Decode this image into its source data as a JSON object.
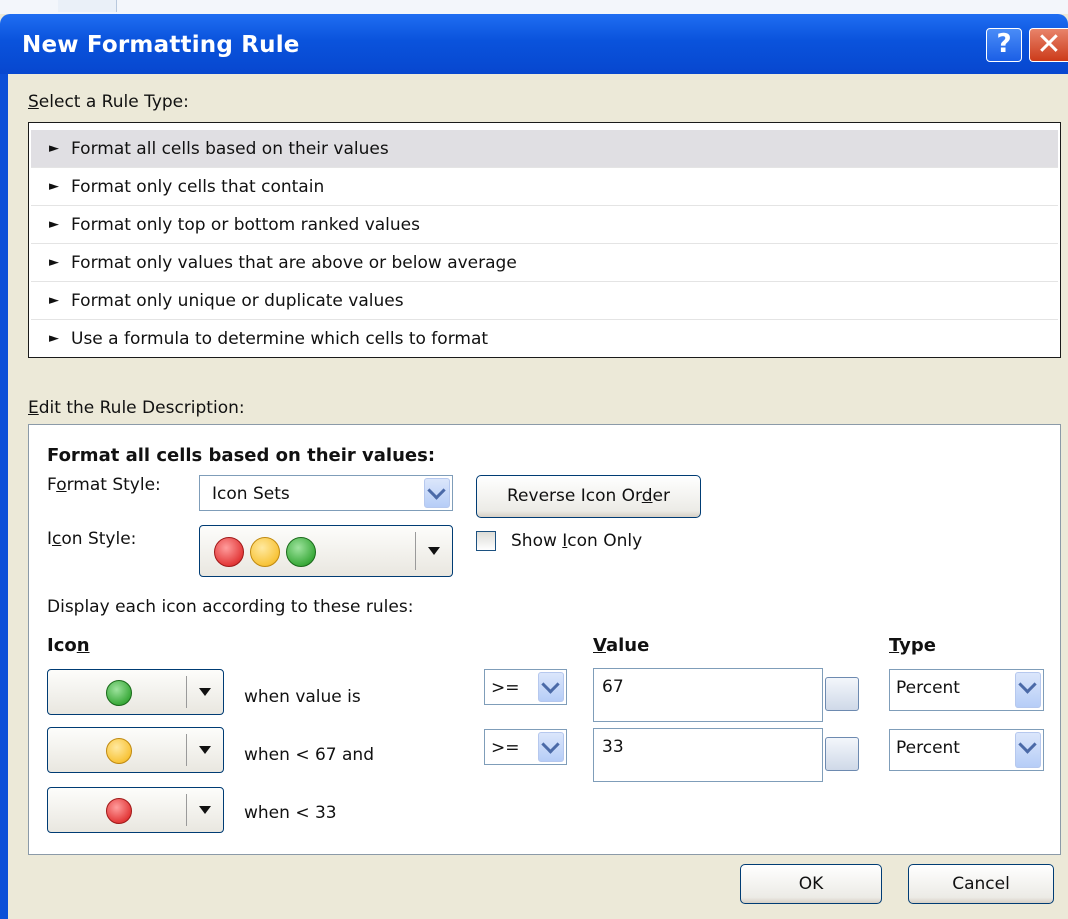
{
  "window": {
    "title": "New Formatting Rule",
    "help_label": "?",
    "close_label": "✕"
  },
  "rule_type": {
    "label_pre": "",
    "label_key": "S",
    "label_post": "elect a Rule Type:",
    "items": [
      {
        "label": "Format all cells based on their values",
        "selected": true
      },
      {
        "label": "Format only cells that contain",
        "selected": false
      },
      {
        "label": "Format only top or bottom ranked values",
        "selected": false
      },
      {
        "label": "Format only values that are above or below average",
        "selected": false
      },
      {
        "label": "Format only unique or duplicate values",
        "selected": false
      },
      {
        "label": "Use a formula to determine which cells to format",
        "selected": false
      }
    ],
    "bullet": "►"
  },
  "description": {
    "label_key": "E",
    "label_post": "dit the Rule Description:",
    "heading": "Format all cells based on their values:",
    "format_style": {
      "label_pre": "F",
      "label_key": "o",
      "label_post": "rmat Style:",
      "value": "Icon Sets"
    },
    "reverse_button": {
      "pre": "Reverse Icon Or",
      "key": "d",
      "post": "er"
    },
    "icon_style": {
      "label_pre": "I",
      "label_key": "c",
      "label_post": "on Style:",
      "icons": [
        "red",
        "yellow",
        "green"
      ]
    },
    "show_icon_only": {
      "pre": "Show ",
      "key": "I",
      "post": "con Only",
      "checked": false
    },
    "display_rules_label": "Display each icon according to these rules:",
    "columns": {
      "icon": {
        "pre": "Ico",
        "key": "n",
        "post": ""
      },
      "value": {
        "pre": "",
        "key": "V",
        "post": "alue"
      },
      "type": {
        "pre": "",
        "key": "T",
        "post": "ype"
      }
    },
    "rules": [
      {
        "icon": "green",
        "condition": "when value is",
        "operator": ">=",
        "value": "67",
        "type": "Percent"
      },
      {
        "icon": "yellow",
        "condition": "when < 67 and",
        "operator": ">=",
        "value": "33",
        "type": "Percent"
      },
      {
        "icon": "red",
        "condition": "when < 33"
      }
    ]
  },
  "buttons": {
    "ok": "OK",
    "cancel": "Cancel"
  }
}
